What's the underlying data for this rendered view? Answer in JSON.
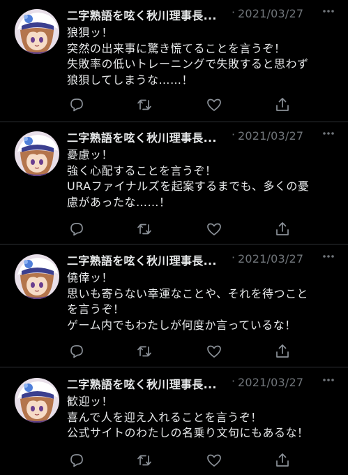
{
  "timeline": {
    "tweets": [
      {
        "author": "二字熟語を呟く秋川理事長...",
        "separator": "·",
        "date": "2021/03/27",
        "text_lines": [
          "狼狽ッ！",
          "突然の出来事に驚き慌てることを言うぞ！",
          "失敗率の低いトレーニングで失敗すると思わず",
          "狼狽してしまうな……！"
        ]
      },
      {
        "author": "二字熟語を呟く秋川理事長...",
        "separator": "·",
        "date": "2021/03/27",
        "text_lines": [
          "憂慮ッ！",
          "強く心配することを言うぞ！",
          "URAファイナルズを起案するまでも、多くの憂",
          "慮があったな……！"
        ]
      },
      {
        "author": "二字熟語を呟く秋川理事長...",
        "separator": "·",
        "date": "2021/03/27",
        "text_lines": [
          "僥倖ッ！",
          "思いも寄らない幸運なことや、それを待つこと",
          "を言うぞ！",
          "ゲーム内でもわたしが何度か言っているな！"
        ]
      },
      {
        "author": "二字熟語を呟く秋川理事長...",
        "separator": "·",
        "date": "2021/03/27",
        "text_lines": [
          "歓迎ッ！",
          "喜んで人を迎え入れることを言うぞ！",
          "公式サイトのわたしの名乗り文句にもあるな！"
        ]
      }
    ]
  },
  "icons": {
    "more": "more-dots-icon",
    "reply": "reply-bubble-icon",
    "retweet": "retweet-arrows-icon",
    "like": "heart-icon",
    "share": "share-upload-icon"
  },
  "colors": {
    "background": "#000000",
    "text": "#e7e9ea",
    "secondary_text": "#71767b",
    "divider": "#2f3336"
  }
}
